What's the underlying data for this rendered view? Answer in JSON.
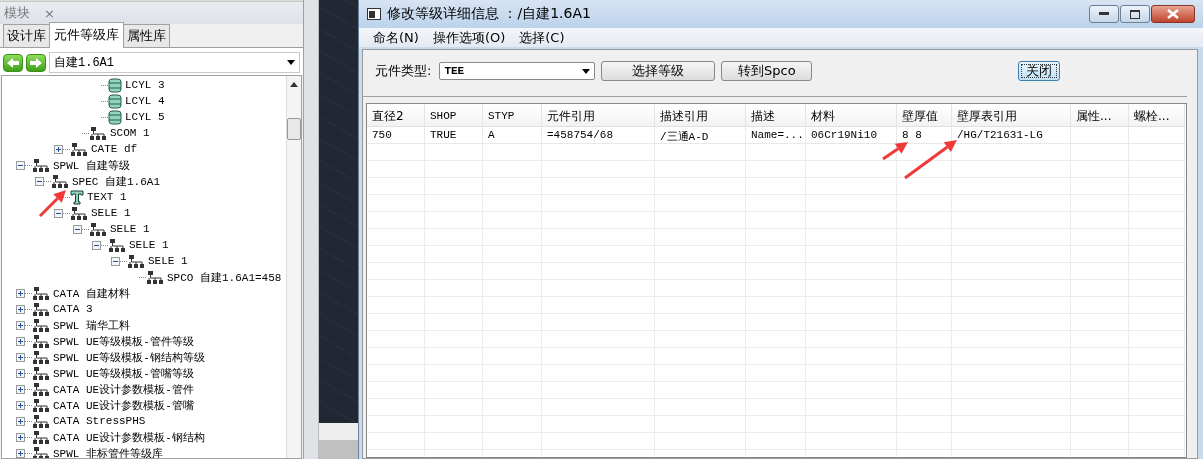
{
  "left_panel": {
    "title": "模块",
    "close": "×",
    "tabs": [
      {
        "label": "设计库",
        "selected": false
      },
      {
        "label": "元件等级库",
        "selected": true
      },
      {
        "label": "属性库",
        "selected": false
      }
    ],
    "library": {
      "value": "自建1.6A1"
    },
    "tree": [
      {
        "children": [
          {
            "children": [
              {
                "children": [
                  {
                    "children": [
                      {
                        "label": "LCYL 3",
                        "kind": "cylinder"
                      },
                      {
                        "label": "LCYL 4",
                        "kind": "cylinder"
                      },
                      {
                        "label": "LCYL 5",
                        "kind": "cylinder"
                      }
                    ]
                  },
                  {
                    "label": "SCOM 1",
                    "kind": "element"
                  }
                ]
              },
              {
                "label": "CATE df",
                "kind": "element",
                "expanded": false
              }
            ]
          }
        ]
      },
      {
        "label": "SPWL 自建等级",
        "kind": "element",
        "expanded": true,
        "children": [
          {
            "label": "SPEC 自建1.6A1",
            "kind": "element",
            "expanded": true,
            "children": [
              {
                "label": "TEXT 1",
                "kind": "text"
              },
              {
                "label": "SELE 1",
                "kind": "element",
                "expanded": true,
                "children": [
                  {
                    "label": "SELE 1",
                    "kind": "element",
                    "expanded": true,
                    "children": [
                      {
                        "label": "SELE 1",
                        "kind": "element",
                        "expanded": true,
                        "children": [
                          {
                            "label": "SELE 1",
                            "kind": "element",
                            "expanded": true,
                            "children": [
                              {
                                "label": "SPCO 自建1.6A1=458",
                                "kind": "element"
                              }
                            ]
                          }
                        ]
                      }
                    ]
                  }
                ]
              }
            ]
          }
        ]
      },
      {
        "label": "CATA 自建材料",
        "kind": "element",
        "expanded": false
      },
      {
        "label": "CATA 3",
        "kind": "element",
        "expanded": false
      },
      {
        "label": "SPWL 瑞华工料",
        "kind": "element",
        "expanded": false
      },
      {
        "label": "SPWL UE等级模板-管件等级",
        "kind": "element",
        "expanded": false
      },
      {
        "label": "SPWL UE等级模板-钢结构等级",
        "kind": "element",
        "expanded": false
      },
      {
        "label": "SPWL UE等级模板-管嘴等级",
        "kind": "element",
        "expanded": false
      },
      {
        "label": "CATA UE设计参数模板-管件",
        "kind": "element",
        "expanded": false
      },
      {
        "label": "CATA UE设计参数模板-管嘴",
        "kind": "element",
        "expanded": false
      },
      {
        "label": "CATA StressPHS",
        "kind": "element",
        "expanded": false
      },
      {
        "label": "CATA UE设计参数模板-钢结构",
        "kind": "element",
        "expanded": false
      },
      {
        "label": "SPWL 非标管件等级库",
        "kind": "element",
        "expanded": false
      }
    ]
  },
  "dialog": {
    "title": "修改等级详细信息 ：/自建1.6A1",
    "menu": [
      "命名(N)",
      "操作选项(O)",
      "选择(C)"
    ],
    "type_label": "元件类型:",
    "type_value": "TEE",
    "buttons": [
      "选择等级",
      "转到Spco"
    ],
    "close_button": "关闭",
    "table": {
      "columns": [
        "直径2",
        "SHOP",
        "STYP",
        "元件引用",
        "描述引用",
        "描述",
        "材料",
        "壁厚值",
        "壁厚表引用",
        "属性...",
        "螺栓..."
      ],
      "rows": [
        [
          "750",
          "TRUE",
          "A",
          "=458754/68",
          "/三通A-D",
          "Name=...",
          "06Cr19Ni10",
          "8 8",
          "/HG/T21631-LG",
          "",
          ""
        ]
      ]
    }
  }
}
